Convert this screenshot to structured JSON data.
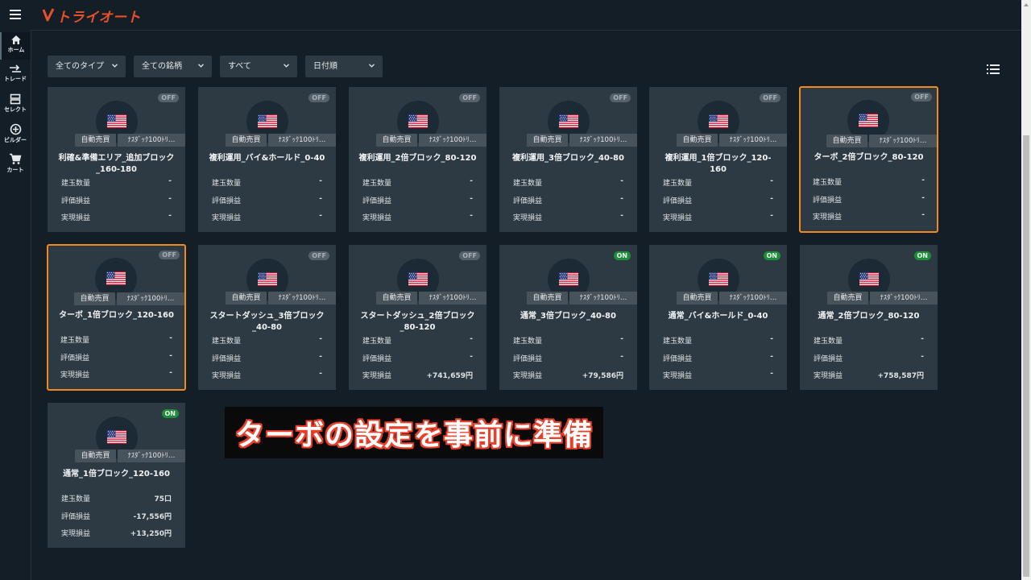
{
  "brand": {
    "name": "トライオート",
    "color": "#e8502a"
  },
  "sidebar": {
    "items": [
      {
        "label": "ホーム",
        "icon": "home-icon",
        "active": true
      },
      {
        "label": "トレード",
        "icon": "trade-icon",
        "active": false
      },
      {
        "label": "セレクト",
        "icon": "select-icon",
        "active": false
      },
      {
        "label": "ビルダー",
        "icon": "builder-icon",
        "active": false
      },
      {
        "label": "カート",
        "icon": "cart-icon",
        "active": false
      }
    ]
  },
  "filters": [
    {
      "label": "全てのタイプ"
    },
    {
      "label": "全ての銘柄"
    },
    {
      "label": "すべて"
    },
    {
      "label": "日付順"
    }
  ],
  "card_labels": {
    "tag_auto": "自動売買",
    "tag_symbol": "ﾅｽﾀﾞｯｸ100ﾄﾘ…",
    "position_qty": "建玉数量",
    "unrealized_pl": "評価損益",
    "realized_pl": "実現損益"
  },
  "cards": [
    {
      "status": "OFF",
      "title": "利確&準備エリア_追加ブロック_160-180",
      "qty": "-",
      "unrealized": "-",
      "realized": "-",
      "selected": false
    },
    {
      "status": "OFF",
      "title": "複利運用_バイ&ホールド_0-40",
      "qty": "-",
      "unrealized": "-",
      "realized": "-",
      "selected": false
    },
    {
      "status": "OFF",
      "title": "複利運用_2倍ブロック_80-120",
      "qty": "-",
      "unrealized": "-",
      "realized": "-",
      "selected": false
    },
    {
      "status": "OFF",
      "title": "複利運用_3倍ブロック_40-80",
      "qty": "-",
      "unrealized": "-",
      "realized": "-",
      "selected": false
    },
    {
      "status": "OFF",
      "title": "複利運用_1倍ブロック_120-160",
      "qty": "-",
      "unrealized": "-",
      "realized": "-",
      "selected": false
    },
    {
      "status": "OFF",
      "title": "ターボ_2倍ブロック_80-120",
      "qty": "-",
      "unrealized": "-",
      "realized": "-",
      "selected": true
    },
    {
      "status": "OFF",
      "title": "ターボ_1倍ブロック_120-160",
      "qty": "-",
      "unrealized": "-",
      "realized": "-",
      "selected": true
    },
    {
      "status": "OFF",
      "title": "スタートダッシュ_3倍ブロック_40-80",
      "qty": "-",
      "unrealized": "-",
      "realized": "-",
      "selected": false
    },
    {
      "status": "OFF",
      "title": "スタートダッシュ_2倍ブロック_80-120",
      "qty": "-",
      "unrealized": "-",
      "realized": "+741,659円",
      "selected": false
    },
    {
      "status": "ON",
      "title": "通常_3倍ブロック_40-80",
      "qty": "-",
      "unrealized": "-",
      "realized": "+79,586円",
      "selected": false
    },
    {
      "status": "ON",
      "title": "通常_バイ&ホールド_0-40",
      "qty": "-",
      "unrealized": "-",
      "realized": "-",
      "selected": false
    },
    {
      "status": "ON",
      "title": "通常_2倍ブロック_80-120",
      "qty": "-",
      "unrealized": "-",
      "realized": "+758,587円",
      "selected": false
    },
    {
      "status": "ON",
      "title": "通常_1倍ブロック_120-160",
      "qty": "75口",
      "unrealized": "-17,556円",
      "realized": "+13,250円",
      "selected": false
    }
  ],
  "overlay_caption": "ターボの設定を事前に準備",
  "colors": {
    "accent_selected": "#f08a1e",
    "status_on": "#1e8d3a",
    "status_off": "#56616a",
    "card_bg": "#2d3a43",
    "page_bg": "#131e27"
  }
}
